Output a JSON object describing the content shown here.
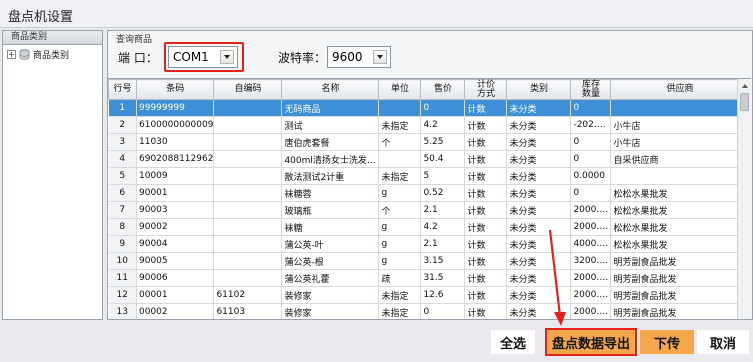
{
  "window": {
    "title": "盘点机设置"
  },
  "sidebar": {
    "header": "商品类别",
    "tree": [
      {
        "expander": "+",
        "icon": "database-icon",
        "label": "商品类别"
      }
    ]
  },
  "main": {
    "group_label": "查询商品",
    "port": {
      "label": "端 口：",
      "value": "COM1"
    },
    "baud": {
      "label": "波特率：",
      "value": "9600"
    }
  },
  "table": {
    "columns": [
      "行号",
      "条码",
      "自编码",
      "名称",
      "单位",
      "售价",
      "计价\n方式",
      "类别",
      "库存\n数量",
      "供应商"
    ],
    "rows": [
      [
        "1",
        "99999999",
        "",
        "无码商品",
        "",
        "0",
        "计数",
        "未分类",
        "0",
        ""
      ],
      [
        "2",
        "6100000000009",
        "",
        "测试",
        "未指定",
        "4.2",
        "计数",
        "未分类",
        "-202.…",
        "小牛店"
      ],
      [
        "3",
        "11030",
        "",
        "唐伯虎套餐",
        "个",
        "5.25",
        "计数",
        "未分类",
        "0",
        "小牛店"
      ],
      [
        "4",
        "6902088112962",
        "",
        "400ml清扬女士洗发…",
        "",
        "50.4",
        "计数",
        "未分类",
        "0",
        "自采供应商"
      ],
      [
        "5",
        "10009",
        "",
        "散法测试2计重",
        "未指定",
        "5",
        "计数",
        "未分类",
        "0.0000",
        ""
      ],
      [
        "6",
        "90001",
        "",
        "袜糖蓉",
        "g",
        "0.52",
        "计数",
        "未分类",
        "0",
        "松松水果批发"
      ],
      [
        "7",
        "90003",
        "",
        "玻璃瓶",
        "个",
        "2.1",
        "计数",
        "未分类",
        "2000.…",
        "松松水果批发"
      ],
      [
        "8",
        "90002",
        "",
        "袜糖",
        "g",
        "4.2",
        "计数",
        "未分类",
        "2000.…",
        "松松水果批发"
      ],
      [
        "9",
        "90004",
        "",
        "蒲公英-叶",
        "g",
        "2.1",
        "计数",
        "未分类",
        "4000.…",
        "松松水果批发"
      ],
      [
        "10",
        "90005",
        "",
        "蒲公英-根",
        "g",
        "3.15",
        "计数",
        "未分类",
        "3200.…",
        "明芳副食品批发"
      ],
      [
        "11",
        "90006",
        "",
        "蒲公英礼藿",
        "疏",
        "31.5",
        "计数",
        "未分类",
        "2000.…",
        "明芳副食品批发"
      ],
      [
        "12",
        "00001",
        "61102",
        "装修家",
        "未指定",
        "12.6",
        "计数",
        "未分类",
        "2000.…",
        "明芳副食品批发"
      ],
      [
        "13",
        "00002",
        "61103",
        "装修家",
        "未指定",
        "0",
        "计数",
        "未分类",
        "2000.…",
        "明芳副食品批发"
      ]
    ],
    "selected_row": 0
  },
  "buttons": {
    "select_all": "全选",
    "export": "盘点数据导出",
    "download": "下传",
    "cancel": "取消"
  },
  "colors": {
    "selection": "#3d8fd8",
    "highlight_border": "#e2221a",
    "accent_button": "#f3a74a"
  }
}
